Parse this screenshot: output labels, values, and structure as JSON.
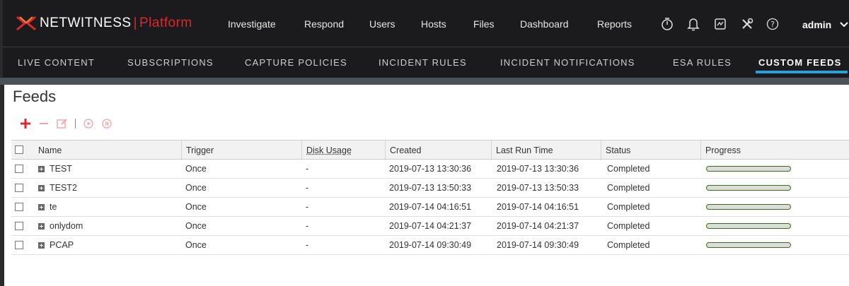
{
  "app": {
    "brand": "NETWITNESS",
    "separator": "|",
    "product": "Platform"
  },
  "topnav": [
    {
      "label": "Investigate"
    },
    {
      "label": "Respond"
    },
    {
      "label": "Users"
    },
    {
      "label": "Hosts"
    },
    {
      "label": "Files"
    },
    {
      "label": "Dashboard"
    },
    {
      "label": "Reports"
    }
  ],
  "topicons": [
    "stopwatch-icon",
    "bell-icon",
    "system-icon",
    "tools-icon",
    "help-icon"
  ],
  "user": {
    "name": "admin"
  },
  "subnav": [
    {
      "label": "LIVE CONTENT"
    },
    {
      "label": "SUBSCRIPTIONS"
    },
    {
      "label": "CAPTURE POLICIES"
    },
    {
      "label": "INCIDENT RULES"
    },
    {
      "label": "INCIDENT NOTIFICATIONS"
    },
    {
      "label": "ESA RULES"
    },
    {
      "label": "CUSTOM FEEDS",
      "active": true
    }
  ],
  "page": {
    "title": "Feeds"
  },
  "toolbar": [
    "add-icon",
    "remove-icon",
    "edit-icon",
    "play-icon",
    "pause-icon"
  ],
  "table": {
    "columns": [
      "Name",
      "Trigger",
      "Disk Usage",
      "Created",
      "Last Run Time",
      "Status",
      "Progress"
    ],
    "rows": [
      {
        "name": "TEST",
        "trigger": "Once",
        "disk": "-",
        "created": "2019-07-13 13:30:36",
        "last_run": "2019-07-13 13:30:36",
        "status": "Completed",
        "progress": 1.0
      },
      {
        "name": "TEST2",
        "trigger": "Once",
        "disk": "-",
        "created": "2019-07-13 13:50:33",
        "last_run": "2019-07-13 13:50:33",
        "status": "Completed",
        "progress": 1.0
      },
      {
        "name": "te",
        "trigger": "Once",
        "disk": "-",
        "created": "2019-07-14 04:16:51",
        "last_run": "2019-07-14 04:16:51",
        "status": "Completed",
        "progress": 1.0
      },
      {
        "name": "onlydom",
        "trigger": "Once",
        "disk": "-",
        "created": "2019-07-14 04:21:37",
        "last_run": "2019-07-14 04:21:37",
        "status": "Completed",
        "progress": 1.0
      },
      {
        "name": "PCAP",
        "trigger": "Once",
        "disk": "-",
        "created": "2019-07-14 09:30:49",
        "last_run": "2019-07-14 09:30:49",
        "status": "Completed",
        "progress": 1.0
      }
    ]
  },
  "colors": {
    "brand_red": "#d9282f",
    "accent_blue": "#2aa0d8",
    "progress_green": "#8cd03a",
    "nav_bg": "#1b1b1d"
  }
}
